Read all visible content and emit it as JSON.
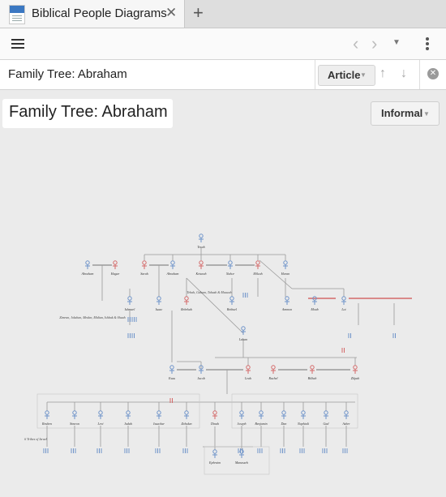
{
  "tab": {
    "title": "Biblical People Diagrams",
    "close_glyph": "✕",
    "new_glyph": "+"
  },
  "toolbar": {
    "back_glyph": "‹",
    "forward_glyph": "›",
    "dropdown_glyph": "▼"
  },
  "docbar": {
    "title": "Family Tree: Abraham",
    "article_label": "Article",
    "caret": "▼",
    "up_glyph": "↑",
    "down_glyph": "↓",
    "close_glyph": "✕"
  },
  "page": {
    "title": "Family Tree: Abraham",
    "mode_label": "Informal"
  },
  "icons": {
    "app": "biblical-people-app-icon",
    "menu": "hamburger-menu-icon",
    "more": "vertical-dots-icon"
  },
  "colors": {
    "male": "#6e93c9",
    "female": "#d46a6a",
    "line": "#9a9a9a"
  },
  "tree": {
    "people": [
      {
        "name": "Terah",
        "g": "m"
      },
      {
        "name": "Abraham",
        "g": "m"
      },
      {
        "name": "Hagar",
        "g": "f"
      },
      {
        "name": "Sarah",
        "g": "f"
      },
      {
        "name": "Abraham",
        "g": "m"
      },
      {
        "name": "Keturah",
        "g": "f"
      },
      {
        "name": "Nahor",
        "g": "m"
      },
      {
        "name": "Milcah",
        "g": "f"
      },
      {
        "name": "Haran",
        "g": "m"
      },
      {
        "name": "Ishmael",
        "g": "m"
      },
      {
        "name": "Isaac",
        "g": "m"
      },
      {
        "name": "Rebekah",
        "g": "f"
      },
      {
        "name": "Bethuel",
        "g": "m"
      },
      {
        "name": "Lot",
        "g": "m"
      },
      {
        "name": "Esau",
        "g": "m"
      },
      {
        "name": "Jacob",
        "g": "m"
      },
      {
        "name": "Leah",
        "g": "f"
      },
      {
        "name": "Rachel",
        "g": "f"
      },
      {
        "name": "Bilhah",
        "g": "f"
      },
      {
        "name": "Zilpah",
        "g": "f"
      },
      {
        "name": "Reuben",
        "g": "m"
      },
      {
        "name": "Simeon",
        "g": "m"
      },
      {
        "name": "Levi",
        "g": "m"
      },
      {
        "name": "Judah",
        "g": "m"
      },
      {
        "name": "Issachar",
        "g": "m"
      },
      {
        "name": "Zebulun",
        "g": "m"
      },
      {
        "name": "Dinah",
        "g": "f"
      },
      {
        "name": "Joseph",
        "g": "m"
      },
      {
        "name": "Benjamin",
        "g": "m"
      },
      {
        "name": "Dan",
        "g": "m"
      },
      {
        "name": "Naphtali",
        "g": "m"
      },
      {
        "name": "Gad",
        "g": "m"
      },
      {
        "name": "Asher",
        "g": "m"
      },
      {
        "name": "Manasseh",
        "g": "m"
      },
      {
        "name": "Ephraim",
        "g": "m"
      },
      {
        "name": "Moab",
        "g": "m"
      },
      {
        "name": "Ammon",
        "g": "m"
      },
      {
        "name": "Laban",
        "g": "m"
      }
    ],
    "notes": [
      "Zimran, Jokshan, Medan, Midian, Ishbak & Shuah",
      "Tebah, Gaham, Tahash & Maacah",
      "6 Tribes of Israel"
    ]
  }
}
